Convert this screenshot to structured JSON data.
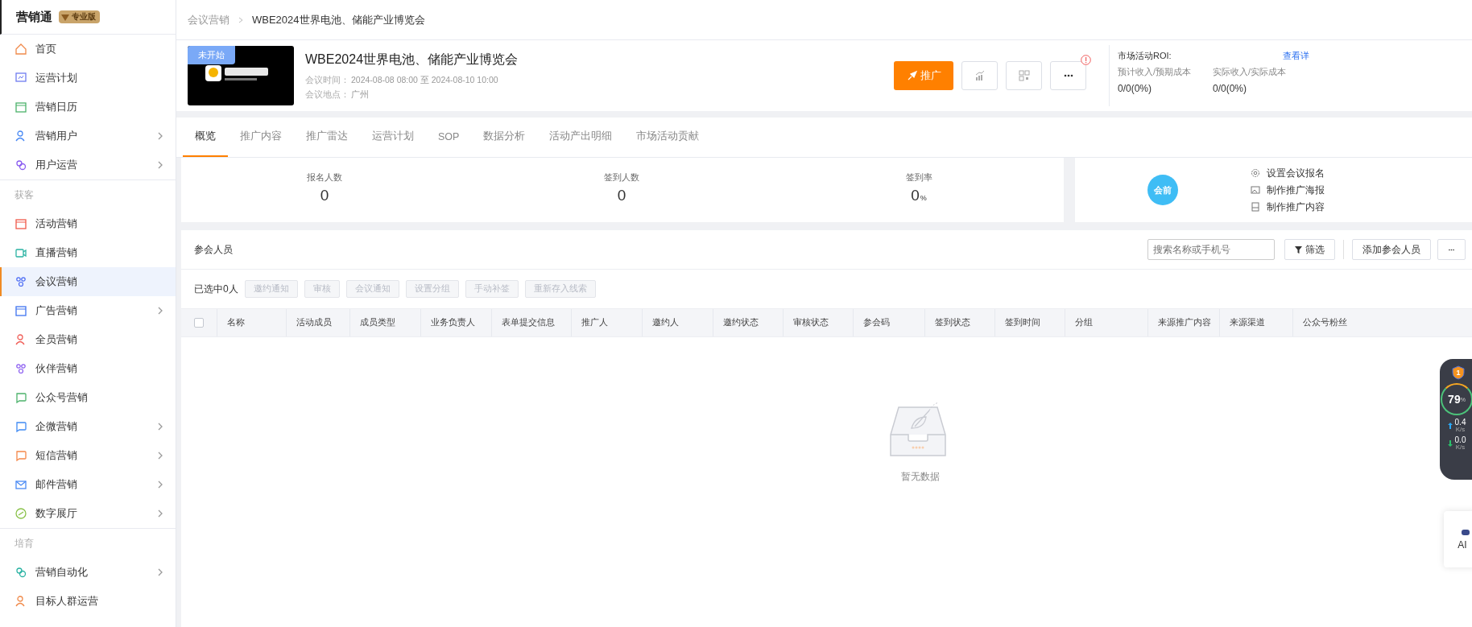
{
  "sidebar": {
    "brand": "营销通",
    "edition": "专业版",
    "items": [
      {
        "kind": "item",
        "label": "首页",
        "has_submenu": false,
        "selected": false
      },
      {
        "kind": "item",
        "label": "运营计划",
        "has_submenu": false,
        "selected": false
      },
      {
        "kind": "item",
        "label": "营销日历",
        "has_submenu": false,
        "selected": false
      },
      {
        "kind": "item",
        "label": "营销用户",
        "has_submenu": true,
        "selected": false
      },
      {
        "kind": "item",
        "label": "用户运营",
        "has_submenu": true,
        "selected": false
      },
      {
        "kind": "section",
        "label": "获客"
      },
      {
        "kind": "item",
        "label": "活动营销",
        "has_submenu": false,
        "selected": false
      },
      {
        "kind": "item",
        "label": "直播营销",
        "has_submenu": false,
        "selected": false
      },
      {
        "kind": "item",
        "label": "会议营销",
        "has_submenu": false,
        "selected": true
      },
      {
        "kind": "item",
        "label": "广告营销",
        "has_submenu": true,
        "selected": false
      },
      {
        "kind": "item",
        "label": "全员营销",
        "has_submenu": false,
        "selected": false
      },
      {
        "kind": "item",
        "label": "伙伴营销",
        "has_submenu": false,
        "selected": false
      },
      {
        "kind": "item",
        "label": "公众号营销",
        "has_submenu": false,
        "selected": false
      },
      {
        "kind": "item",
        "label": "企微营销",
        "has_submenu": true,
        "selected": false
      },
      {
        "kind": "item",
        "label": "短信营销",
        "has_submenu": true,
        "selected": false
      },
      {
        "kind": "item",
        "label": "邮件营销",
        "has_submenu": true,
        "selected": false
      },
      {
        "kind": "item",
        "label": "数字展厅",
        "has_submenu": true,
        "selected": false
      },
      {
        "kind": "section",
        "label": "培育"
      },
      {
        "kind": "item",
        "label": "营销自动化",
        "has_submenu": true,
        "selected": false
      },
      {
        "kind": "item",
        "label": "目标人群运营",
        "has_submenu": false,
        "selected": false
      }
    ]
  },
  "breadcrumb": [
    "会议营销",
    "WBE2024世界电池、储能产业博览会"
  ],
  "event": {
    "status": "未开始",
    "title": "WBE2024世界电池、储能产业博览会",
    "time_label": "会议时间：",
    "time": "2024-08-08 08:00 至 2024-08-10 10:00",
    "place_label": "会议地点：",
    "place": "广州"
  },
  "actions": {
    "promote": "推广"
  },
  "roi": {
    "title": "市场活动ROI:",
    "link": "查看详",
    "metrics": [
      {
        "label": "预计收入/预期成本",
        "value": "0/0(0%)"
      },
      {
        "label": "实际收入/实际成本",
        "value": "0/0(0%)"
      }
    ]
  },
  "tabs": [
    {
      "label": "概览",
      "selected": true
    },
    {
      "label": "推广内容",
      "selected": false
    },
    {
      "label": "推广雷达",
      "selected": false
    },
    {
      "label": "运营计划",
      "selected": false
    },
    {
      "label": "SOP",
      "selected": false
    },
    {
      "label": "数据分析",
      "selected": false
    },
    {
      "label": "活动产出明细",
      "selected": false
    },
    {
      "label": "市场活动贡献",
      "selected": false
    }
  ],
  "stats": [
    {
      "label": "报名人数",
      "value": "0"
    },
    {
      "label": "签到人数",
      "value": "0"
    },
    {
      "label": "签到率",
      "value": "0",
      "unit": "%"
    }
  ],
  "stage": {
    "label": "会前",
    "actions": [
      "设置会议报名",
      "制作推广海报",
      "制作推广内容"
    ]
  },
  "participants": {
    "title": "参会人员",
    "search_placeholder": "搜索名称或手机号",
    "filter": "筛选",
    "add": "添加参会人员",
    "selected_count": "已选中0人",
    "batch_actions": [
      {
        "label": "邀约通知",
        "disabled": true
      },
      {
        "label": "审核",
        "disabled": true
      },
      {
        "label": "会议通知",
        "disabled": true
      },
      {
        "label": "设置分组",
        "disabled": true
      },
      {
        "label": "手动补签",
        "disabled": true
      },
      {
        "label": "重新存入线索",
        "disabled": true
      }
    ],
    "select_all": {
      "checked": false
    },
    "columns": [
      "名称",
      "活动成员",
      "成员类型",
      "业务负责人",
      "表单提交信息",
      "推广人",
      "邀约人",
      "邀约状态",
      "审核状态",
      "参会码",
      "签到状态",
      "签到时间",
      "分组",
      "来源推广内容",
      "来源渠道",
      "公众号粉丝"
    ],
    "empty": "暂无数据"
  },
  "speed_widget": {
    "badge": "1",
    "percent": "79",
    "percent_unit": "%",
    "up": {
      "value": "0.4",
      "unit": "K/s"
    },
    "down": {
      "value": "0.0",
      "unit": "K/s"
    }
  },
  "ai_widget": {
    "label": "AI"
  }
}
